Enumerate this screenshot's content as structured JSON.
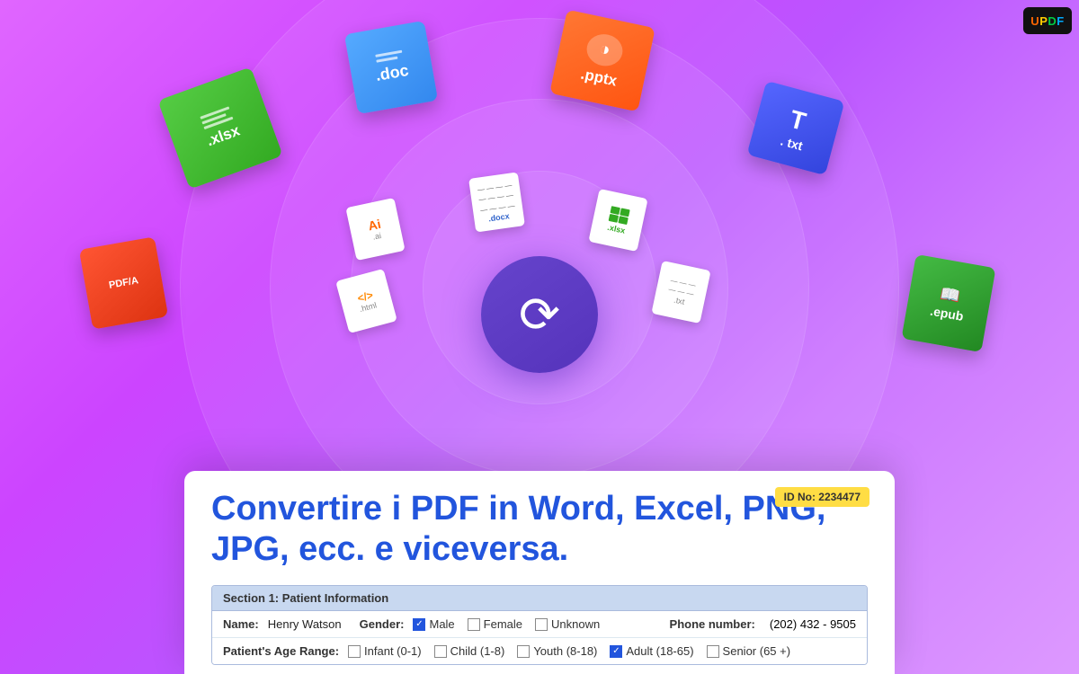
{
  "app": {
    "logo": "UPDF",
    "logo_letters": [
      "U",
      "P",
      "D",
      "F"
    ],
    "logo_colors": [
      "#ff6600",
      "#ffcc00",
      "#00cc44",
      "#00aaff"
    ]
  },
  "file_icons": [
    {
      "id": "doc",
      "label": ".doc",
      "color_from": "#55aaff",
      "color_to": "#3388ee"
    },
    {
      "id": "pptx",
      "label": ".pptx",
      "color_from": "#ff7733",
      "color_to": "#ff5511"
    },
    {
      "id": "xlsx",
      "label": ".xlsx",
      "color_from": "#55cc44",
      "color_to": "#33aa22"
    },
    {
      "id": "txt",
      "label": ". txt",
      "color_from": "#5566ff",
      "color_to": "#3344dd"
    },
    {
      "id": "pdfa",
      "label": "PDF/A",
      "color_from": "#ff5533",
      "color_to": "#dd3311"
    },
    {
      "id": "epub",
      "label": ".epub",
      "color_from": "#44bb44",
      "color_to": "#228822"
    }
  ],
  "small_icons": [
    {
      "label": ".docx"
    },
    {
      "label": ".xlsx"
    },
    {
      "label": ".html"
    },
    {
      "label": ".txt"
    },
    {
      "label": ".ai"
    }
  ],
  "center_icon": {
    "symbol": "↻",
    "aria": "convert"
  },
  "document": {
    "id_badge": "ID No: 2234477",
    "title": "Convertire i PDF in Word, Excel, PNG, JPG, ecc. e viceversa.",
    "section_header": "Section 1: Patient Information",
    "name_label": "Name:",
    "name_value": "Henry Watson",
    "gender_label": "Gender:",
    "gender_options": [
      {
        "label": "Male",
        "checked": true
      },
      {
        "label": "Female",
        "checked": false
      },
      {
        "label": "Unknown",
        "checked": false
      }
    ],
    "phone_label": "Phone number:",
    "phone_value": "(202) 432 - 9505",
    "age_label": "Patient's Age Range:",
    "age_options": [
      {
        "label": "Infant (0-1)",
        "checked": false
      },
      {
        "label": "Child (1-8)",
        "checked": false
      },
      {
        "label": "Youth (8-18)",
        "checked": false
      },
      {
        "label": "Adult (18-65)",
        "checked": true
      },
      {
        "label": "Senior (65 +)",
        "checked": false
      }
    ]
  }
}
